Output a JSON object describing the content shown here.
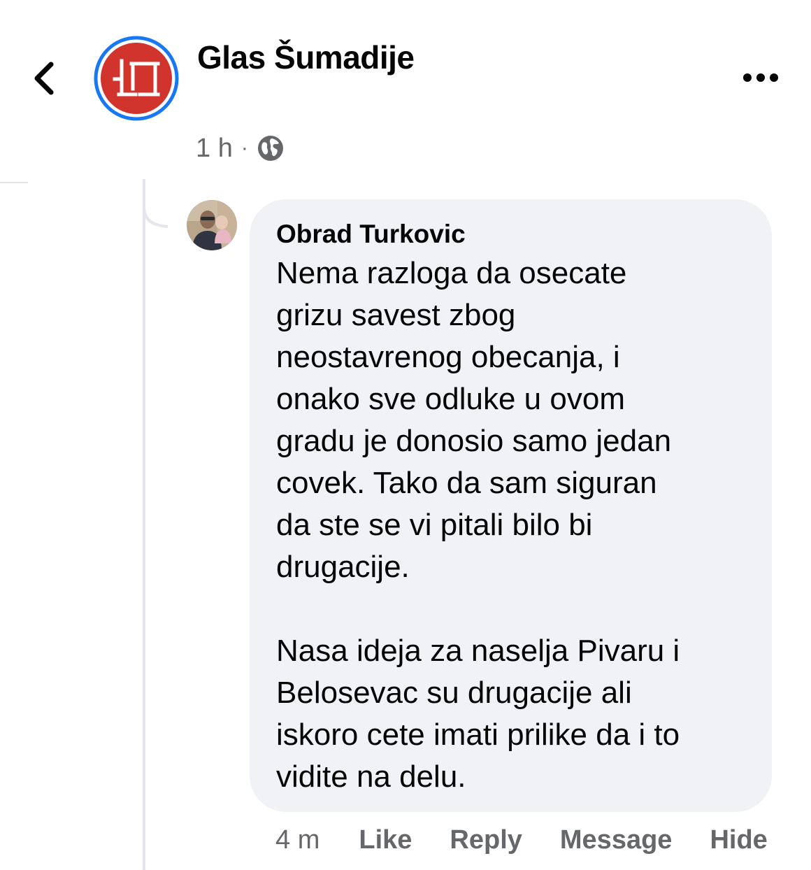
{
  "header": {
    "back_icon": "chevron-left-icon",
    "page_name": "Glas Šumadije",
    "more_icon": "ellipsis-icon",
    "logo_color": "#d0342c",
    "logo_ring_color": "#1877f2"
  },
  "post": {
    "time": "1 h",
    "separator": "·",
    "audience_icon": "globe-icon"
  },
  "comment": {
    "author": "Obrad Turkovic",
    "text": "Nema razloga da osecate\ngrizu savest zbog\nneostavrenog obecanja, i\nonako sve odluke u ovom\ngradu je donosio samo jedan\ncovek. Tako da sam siguran\nda ste se vi pitali bilo bi\ndrugacije.\n\nNasa ideja za naselja Pivaru i\nBelosevac su drugacije ali\niskoro cete imati prilike da i to\nvidite na delu.",
    "bubble_color": "#f0f2f5"
  },
  "actions": {
    "time": "4 m",
    "like": "Like",
    "reply": "Reply",
    "message": "Message",
    "hide": "Hide"
  }
}
